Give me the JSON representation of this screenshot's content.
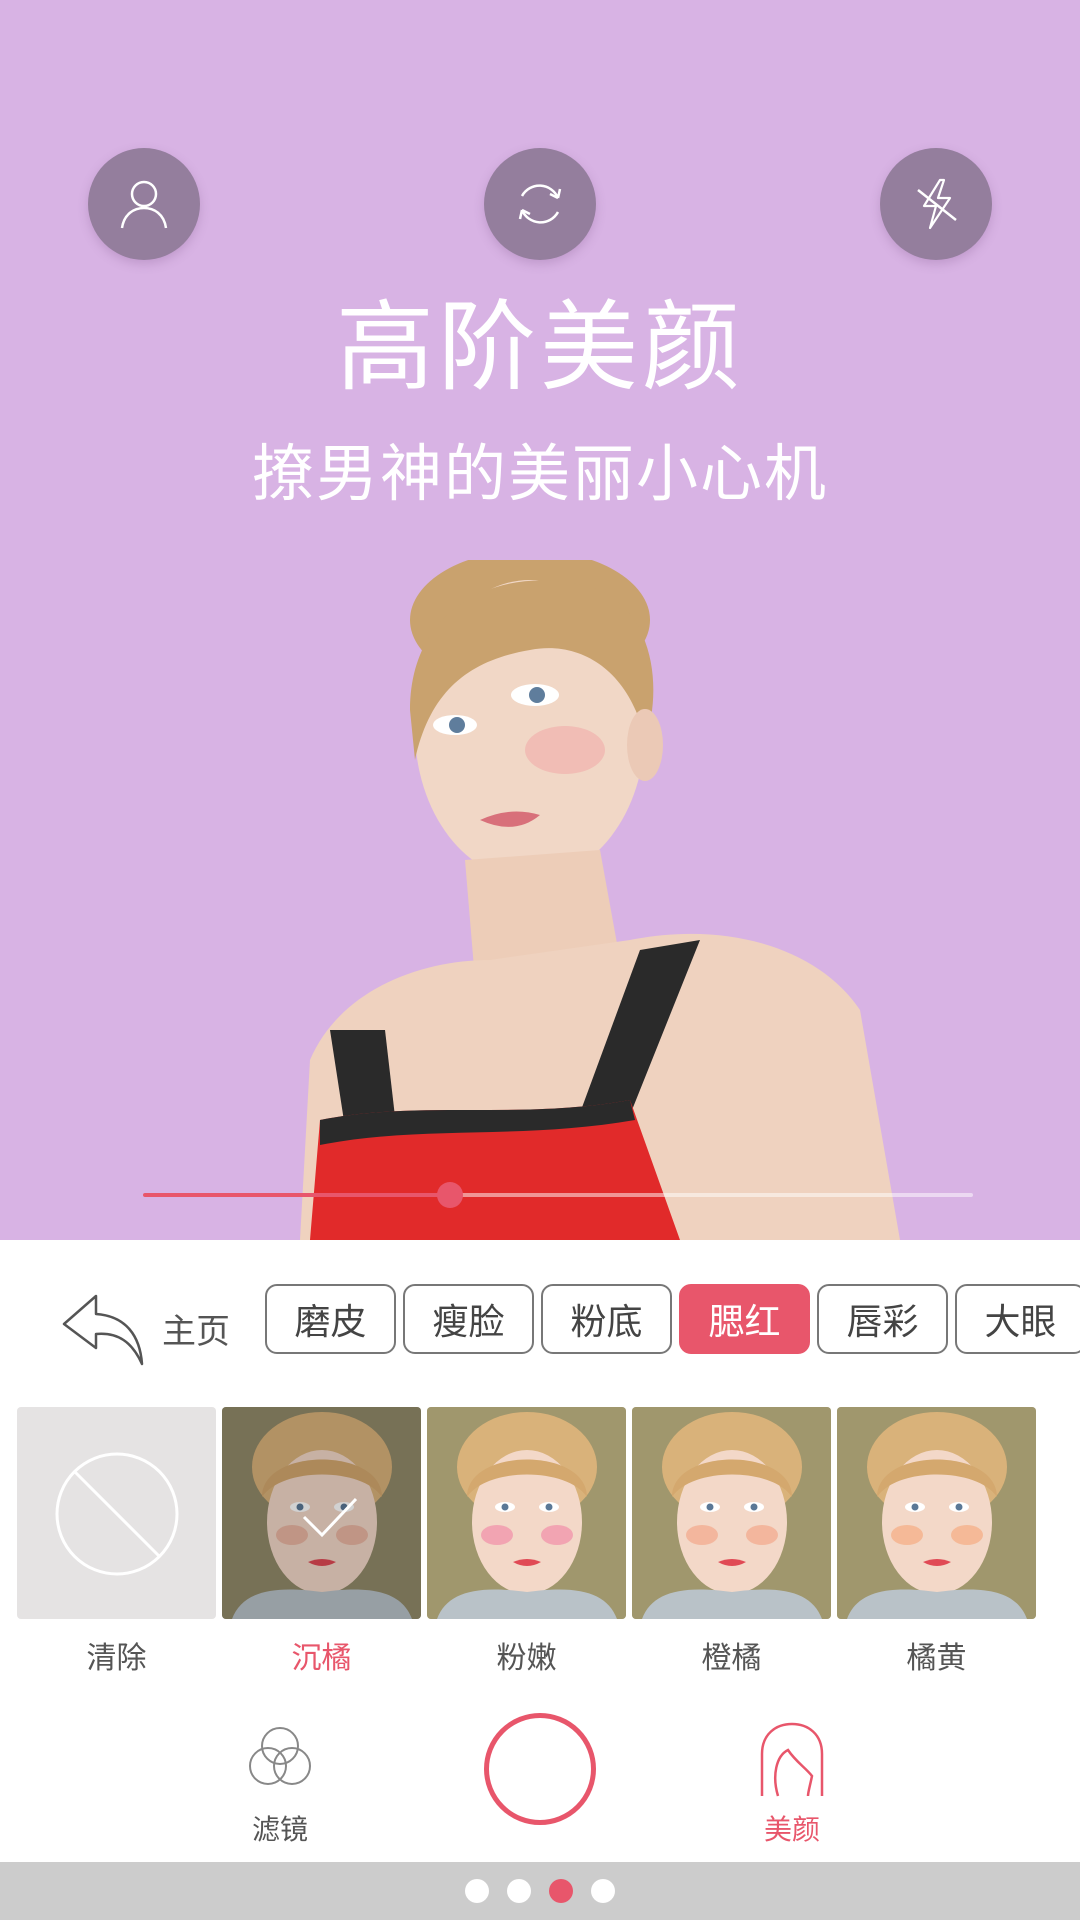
{
  "preview": {
    "background_color": "#d8b3e4",
    "headline": "高阶美颜",
    "subline": "撩男神的美丽小心机",
    "top_buttons": [
      {
        "icon": "profile-icon"
      },
      {
        "icon": "switch-camera-icon"
      },
      {
        "icon": "flash-off-icon"
      }
    ],
    "intensity": 0.37
  },
  "toolbar": {
    "home_label": "主页",
    "home_icon": "back-arrow-icon",
    "tabs": [
      {
        "label": "磨皮",
        "active": false
      },
      {
        "label": "瘦脸",
        "active": false
      },
      {
        "label": "粉底",
        "active": false
      },
      {
        "label": "腮红",
        "active": true
      },
      {
        "label": "唇彩",
        "active": false
      },
      {
        "label": "大眼",
        "active": false
      }
    ]
  },
  "effects": [
    {
      "name": "清除",
      "type": "clear",
      "selected": false
    },
    {
      "name": "沉橘",
      "type": "photo",
      "selected": true,
      "blush": "#e49a85"
    },
    {
      "name": "粉嫩",
      "type": "photo",
      "selected": false,
      "blush": "#f07aa0"
    },
    {
      "name": "橙橘",
      "type": "photo",
      "selected": false,
      "blush": "#f29a7a"
    },
    {
      "name": "橘黄",
      "type": "photo",
      "selected": false,
      "blush": "#f5a070"
    }
  ],
  "bottom": {
    "filter_label": "滤镜",
    "filter_icon": "filter-circles-icon",
    "beauty_label": "美颜",
    "beauty_icon": "beauty-face-icon",
    "shutter_icon": "shutter-button"
  },
  "pager": {
    "count": 4,
    "active_index": 2
  },
  "colors": {
    "accent": "#e8566b",
    "button_bg": "#947e9d"
  }
}
